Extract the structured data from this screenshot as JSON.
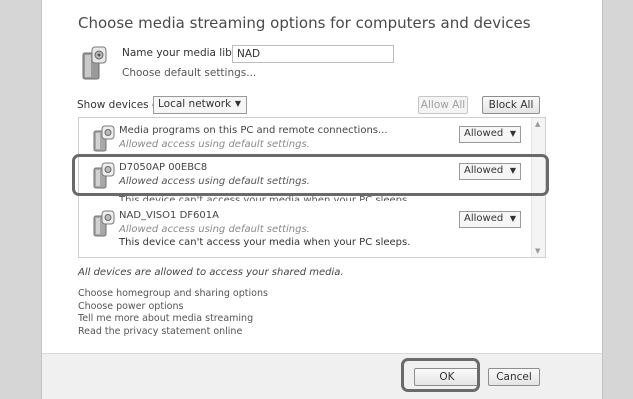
{
  "title": "Choose media streaming options for computers and devices",
  "library": {
    "name_label": "Name your media library:",
    "name_value": "NAD",
    "default_settings_link": "Choose default settings..."
  },
  "filter": {
    "label": "Show devices on:",
    "selected": "Local network",
    "allow_all": "Allow All",
    "block_all": "Block All"
  },
  "devices": [
    {
      "name": "Media programs on this PC and remote connections...",
      "status": "Allowed access using default settings.",
      "permission": "Allowed"
    },
    {
      "name": "D7050AP 00EBC8",
      "status": "Allowed access using default settings.",
      "permission": "Allowed"
    },
    {
      "name": "NAD_VISO1 DF601A",
      "status": "Allowed access using default settings.",
      "note": "This device can't access your media when your PC sleeps.",
      "permission": "Allowed"
    }
  ],
  "clipped_note": "This device can't access your media when your PC sleeps.",
  "all_devices_note": "All devices are allowed to access your shared media.",
  "links": [
    "Choose homegroup and sharing options",
    "Choose power options",
    "Tell me more about media streaming",
    "Read the privacy statement online"
  ],
  "buttons": {
    "ok": "OK",
    "cancel": "Cancel"
  },
  "icons": {
    "library": "media-library-icon",
    "device": "media-device-icon",
    "dropdown_arrow": "chevron-down-icon"
  },
  "colors": {
    "background": "#d6d6d6",
    "window": "#ffffff",
    "footer": "#f0f0f0",
    "highlight": "#6a6a6a"
  }
}
